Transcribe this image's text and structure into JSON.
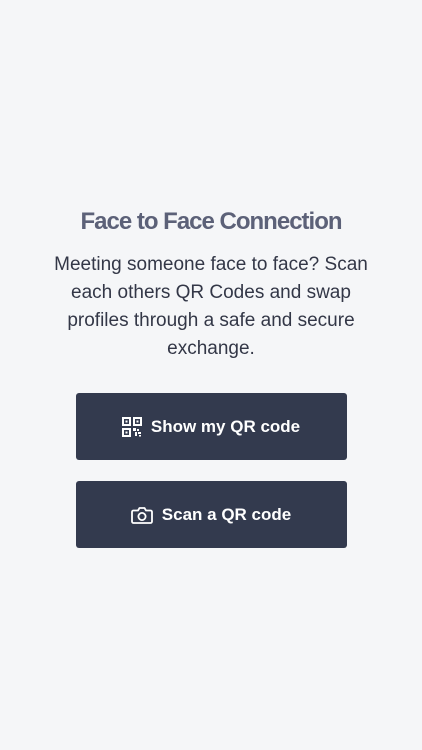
{
  "connection": {
    "title": "Face to Face Connection",
    "description": "Meeting someone face to face? Scan each others QR Codes and swap profiles through a safe and secure exchange."
  },
  "actions": {
    "show_qr": {
      "label": "Show my QR code",
      "icon": "qr-code-icon"
    },
    "scan_qr": {
      "label": "Scan a QR code",
      "icon": "camera-icon"
    }
  },
  "colors": {
    "background": "#f5f6f8",
    "title": "#5c6178",
    "text": "#333747",
    "button": "#333a4e",
    "button_text": "#ffffff"
  }
}
